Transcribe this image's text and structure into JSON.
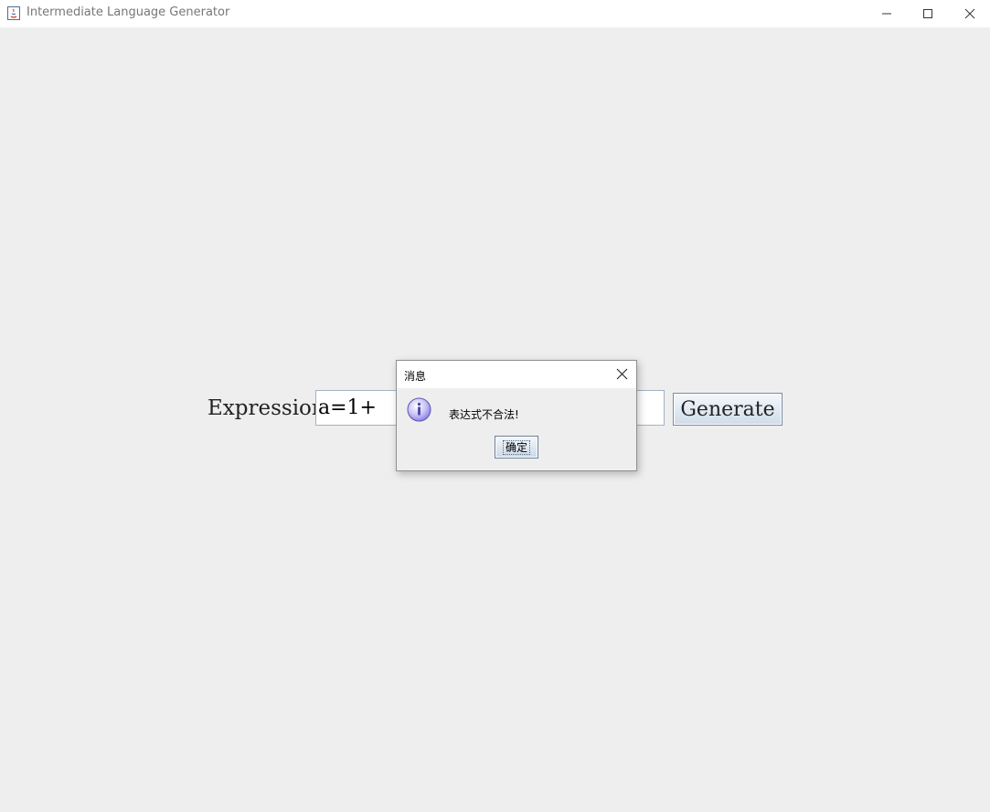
{
  "window": {
    "title": "Intermediate Language Generator"
  },
  "form": {
    "expression_label": "Expression:",
    "expression_value": "a=1+",
    "generate_label": "Generate"
  },
  "dialog": {
    "title": "消息",
    "message": "表达式不合法!",
    "ok_label": "确定"
  },
  "icons": {
    "app": "java-app-icon",
    "minimize": "minimize-icon",
    "maximize": "maximize-icon",
    "close": "close-icon",
    "info": "info-icon"
  },
  "colors": {
    "background": "#eeeeee",
    "titlebar": "#ffffff",
    "button_top": "#f4f8fc",
    "button_bottom": "#cfdcea",
    "info_icon": "#8f86e6"
  }
}
